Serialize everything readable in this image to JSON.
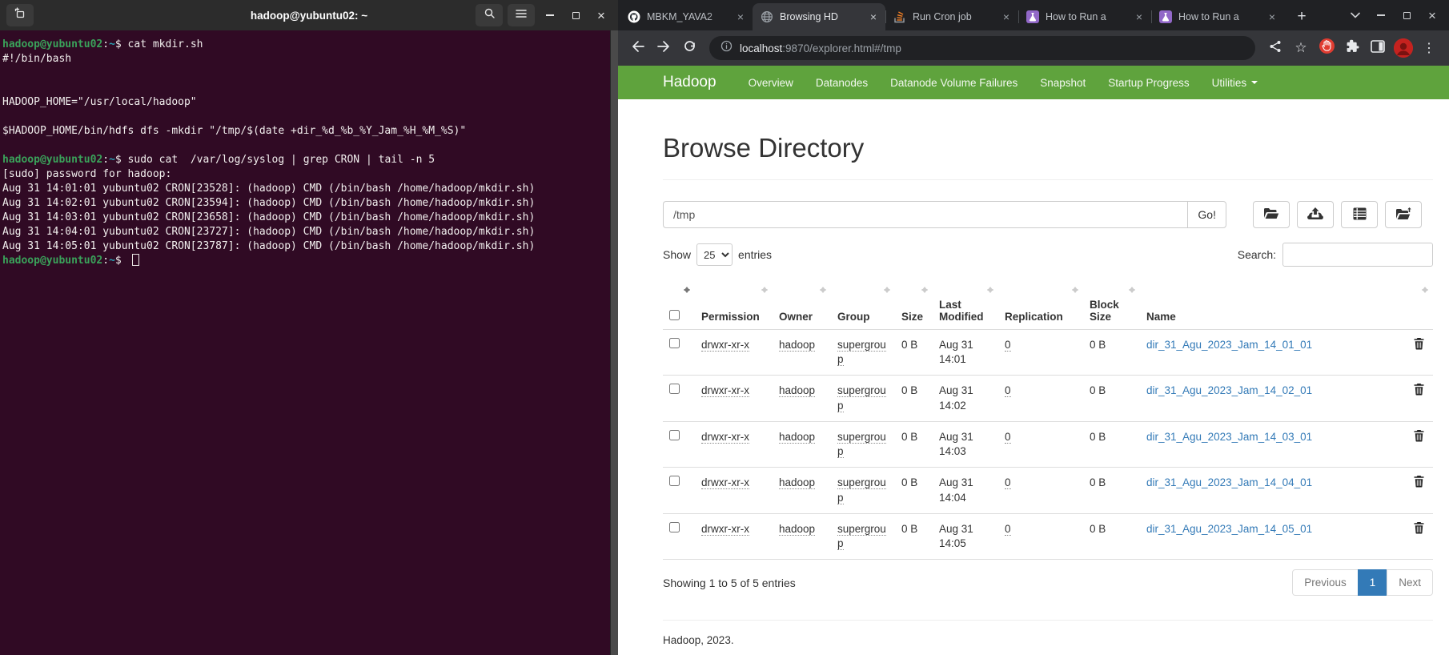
{
  "icons": {
    "minimize": "minimize",
    "maximize": "maximize",
    "close": "×",
    "new_tab": "+",
    "menu_dots": "⋮",
    "star": "☆"
  },
  "terminal": {
    "title": "hadoop@yubuntu02: ~",
    "prompt": {
      "user_host": "hadoop@yubuntu02",
      "separator": ":",
      "cwd": "~",
      "symbol": "$ "
    },
    "lines": [
      {
        "prompt": true,
        "text": "cat mkdir.sh"
      },
      {
        "text": "#!/bin/bash"
      },
      {
        "text": ""
      },
      {
        "text": ""
      },
      {
        "text": "HADOOP_HOME=\"/usr/local/hadoop\""
      },
      {
        "text": ""
      },
      {
        "text": "$HADOOP_HOME/bin/hdfs dfs -mkdir \"/tmp/$(date +dir_%d_%b_%Y_Jam_%H_%M_%S)\""
      },
      {
        "text": ""
      },
      {
        "prompt": true,
        "text": "sudo cat  /var/log/syslog | grep CRON | tail -n 5"
      },
      {
        "text": "[sudo] password for hadoop:"
      },
      {
        "text": "Aug 31 14:01:01 yubuntu02 CRON[23528]: (hadoop) CMD (/bin/bash /home/hadoop/mkdir.sh)"
      },
      {
        "text": "Aug 31 14:02:01 yubuntu02 CRON[23594]: (hadoop) CMD (/bin/bash /home/hadoop/mkdir.sh)"
      },
      {
        "text": "Aug 31 14:03:01 yubuntu02 CRON[23658]: (hadoop) CMD (/bin/bash /home/hadoop/mkdir.sh)"
      },
      {
        "text": "Aug 31 14:04:01 yubuntu02 CRON[23727]: (hadoop) CMD (/bin/bash /home/hadoop/mkdir.sh)"
      },
      {
        "text": "Aug 31 14:05:01 yubuntu02 CRON[23787]: (hadoop) CMD (/bin/bash /home/hadoop/mkdir.sh)"
      },
      {
        "prompt": true,
        "text": "",
        "cursor": true
      }
    ]
  },
  "browser": {
    "tabs": [
      {
        "label": "MBKM_YAVA2",
        "icon": "github",
        "active": false
      },
      {
        "label": "Browsing HD",
        "icon": "globe",
        "active": true
      },
      {
        "label": "Run Cron job",
        "icon": "stackoverflow",
        "active": false
      },
      {
        "label": "How to Run a",
        "icon": "askubuntu",
        "active": false
      },
      {
        "label": "How to Run a",
        "icon": "askubuntu",
        "active": false
      }
    ],
    "url": {
      "host": "localhost",
      "rest": ":9870/explorer.html#/tmp"
    }
  },
  "hadoop": {
    "colors": {
      "navbar": "#5fa33d",
      "link": "#337ab7",
      "active_page": "#337ab7"
    },
    "brand": "Hadoop",
    "nav_items": [
      "Overview",
      "Datanodes",
      "Datanode Volume Failures",
      "Snapshot",
      "Startup Progress"
    ],
    "nav_dropdown": "Utilities",
    "page_title": "Browse Directory",
    "path_value": "/tmp",
    "go_label": "Go!",
    "show_label": "Show",
    "entries_label": "entries",
    "page_size_options": [
      "25"
    ],
    "page_size_selected": "25",
    "search_label": "Search:",
    "columns": [
      {
        "label": "",
        "checkbox": true,
        "sort": true,
        "sorted": true
      },
      {
        "label": "Permission",
        "sort": true
      },
      {
        "label": "Owner",
        "sort": true
      },
      {
        "label": "Group",
        "sort": true
      },
      {
        "label": "Size",
        "sort": true
      },
      {
        "label": "Last Modified",
        "sort": true
      },
      {
        "label": "Replication",
        "sort": true
      },
      {
        "label": "Block Size",
        "sort": true
      },
      {
        "label": "Name",
        "sort": false
      },
      {
        "label": "",
        "sort": true
      }
    ],
    "rows": [
      {
        "permission": "drwxr-xr-x",
        "owner": "hadoop",
        "group": "supergroup",
        "size": "0 B",
        "modified": "Aug 31 14:01",
        "replication": "0",
        "block_size": "0 B",
        "name": "dir_31_Agu_2023_Jam_14_01_01"
      },
      {
        "permission": "drwxr-xr-x",
        "owner": "hadoop",
        "group": "supergroup",
        "size": "0 B",
        "modified": "Aug 31 14:02",
        "replication": "0",
        "block_size": "0 B",
        "name": "dir_31_Agu_2023_Jam_14_02_01"
      },
      {
        "permission": "drwxr-xr-x",
        "owner": "hadoop",
        "group": "supergroup",
        "size": "0 B",
        "modified": "Aug 31 14:03",
        "replication": "0",
        "block_size": "0 B",
        "name": "dir_31_Agu_2023_Jam_14_03_01"
      },
      {
        "permission": "drwxr-xr-x",
        "owner": "hadoop",
        "group": "supergroup",
        "size": "0 B",
        "modified": "Aug 31 14:04",
        "replication": "0",
        "block_size": "0 B",
        "name": "dir_31_Agu_2023_Jam_14_04_01"
      },
      {
        "permission": "drwxr-xr-x",
        "owner": "hadoop",
        "group": "supergroup",
        "size": "0 B",
        "modified": "Aug 31 14:05",
        "replication": "0",
        "block_size": "0 B",
        "name": "dir_31_Agu_2023_Jam_14_05_01"
      }
    ],
    "summary": "Showing 1 to 5 of 5 entries",
    "pagination": {
      "previous": "Previous",
      "page": "1",
      "next": "Next"
    },
    "footer": "Hadoop, 2023."
  }
}
